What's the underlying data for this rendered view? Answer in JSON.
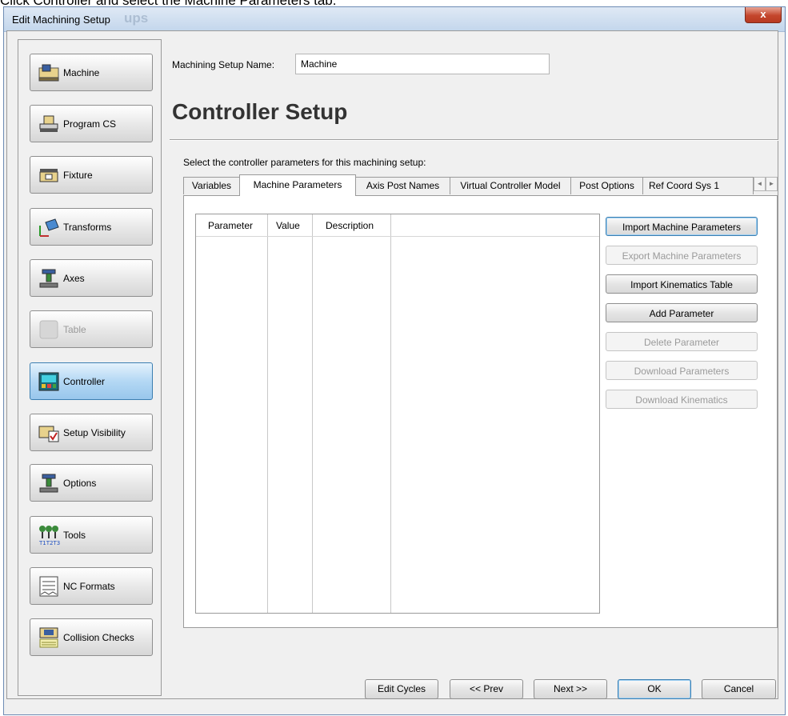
{
  "instruction": "Click Controller and select the Machine Parameters tab.",
  "window": {
    "title": "Edit Machining Setup",
    "ghost_title": "ups",
    "close_label": "x"
  },
  "nav": {
    "items": [
      {
        "label": "Machine",
        "icon": "machine-icon"
      },
      {
        "label": "Program CS",
        "icon": "program-cs-icon"
      },
      {
        "label": "Fixture",
        "icon": "fixture-icon"
      },
      {
        "label": "Transforms",
        "icon": "transforms-icon"
      },
      {
        "label": "Axes",
        "icon": "axes-icon"
      },
      {
        "label": "Table",
        "icon": "table-icon",
        "disabled": true
      },
      {
        "label": "Controller",
        "icon": "controller-icon",
        "selected": true
      },
      {
        "label": "Setup Visibility",
        "icon": "setup-visibility-icon"
      },
      {
        "label": "Options",
        "icon": "options-icon"
      },
      {
        "label": "Tools",
        "icon": "tools-icon"
      },
      {
        "label": "NC Formats",
        "icon": "nc-formats-icon"
      },
      {
        "label": "Collision Checks",
        "icon": "collision-checks-icon"
      }
    ]
  },
  "setup_name": {
    "label": "Machining Setup Name:",
    "value": "Machine"
  },
  "heading": "Controller Setup",
  "subheading": "Select the controller parameters for this machining setup:",
  "tabs": [
    {
      "label": "Variables"
    },
    {
      "label": "Machine Parameters",
      "active": true
    },
    {
      "label": "Axis Post Names"
    },
    {
      "label": "Virtual Controller Model"
    },
    {
      "label": "Post Options"
    },
    {
      "label": "Ref Coord Sys 1"
    }
  ],
  "tab_scroll": {
    "left": "◄",
    "right": "►"
  },
  "grid": {
    "columns": [
      "Parameter",
      "Value",
      "Description"
    ],
    "rows": []
  },
  "actions": [
    {
      "label": "Import Machine Parameters",
      "enabled": true,
      "focused": true
    },
    {
      "label": "Export Machine Parameters",
      "enabled": false
    },
    {
      "label": "Import Kinematics Table",
      "enabled": true
    },
    {
      "label": "Add Parameter",
      "enabled": true
    },
    {
      "label": "Delete Parameter",
      "enabled": false
    },
    {
      "label": "Download Parameters",
      "enabled": false
    },
    {
      "label": "Download Kinematics",
      "enabled": false
    }
  ],
  "footer": {
    "edit_cycles": "Edit Cycles",
    "prev": "<< Prev",
    "next": "Next >>",
    "ok": "OK",
    "cancel": "Cancel"
  },
  "colors": {
    "selected_nav": "#98c6ec",
    "focus_border": "#3c7fb1",
    "close_button": "#c4462c"
  }
}
